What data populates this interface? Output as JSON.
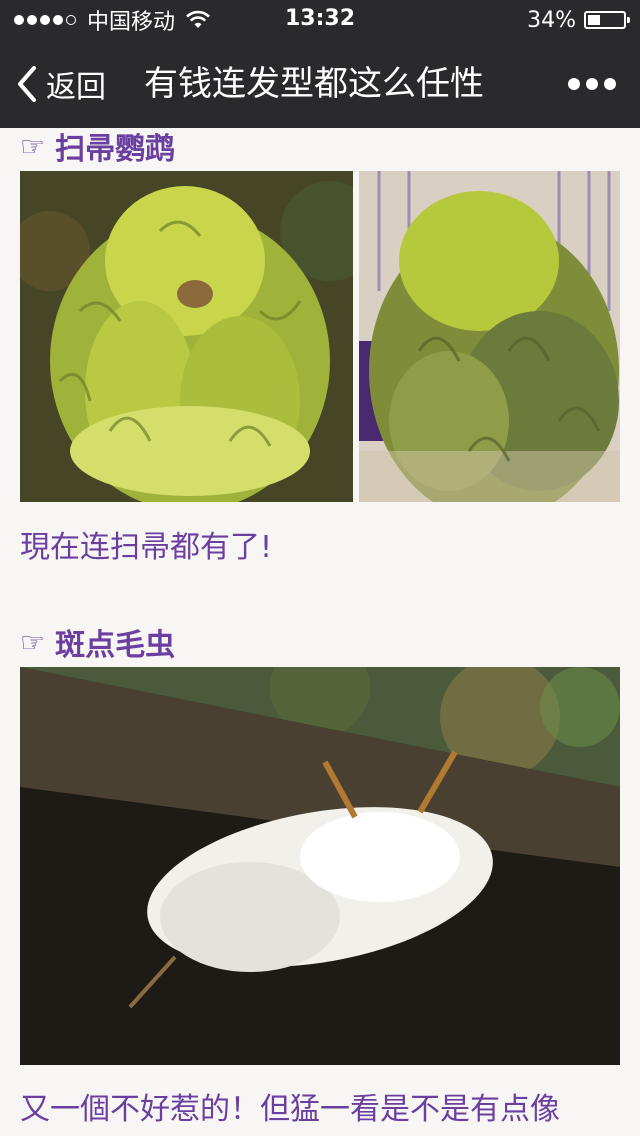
{
  "status_bar": {
    "carrier": "中国移动",
    "time": "13:32",
    "battery_text": "34%",
    "battery_level": 0.34
  },
  "nav": {
    "back_label": "返回",
    "title": "有钱连发型都这么任性"
  },
  "sections": [
    {
      "hand_icon": "☞",
      "heading": "扫帚鹦鹉",
      "caption": "現在连扫帚都有了!"
    },
    {
      "hand_icon": "☞",
      "heading": "斑点毛虫",
      "caption": "又一個不好惹的！但猛一看是不是有点像"
    }
  ],
  "colors": {
    "bar_bg": "#2a2a2c",
    "accent_purple": "#6b3fa0",
    "page_bg": "#f7f6f4"
  },
  "icons": {
    "back": "chevron-left-icon",
    "more": "more-dots-icon",
    "wifi": "wifi-icon",
    "battery": "battery-icon",
    "hand": "pointing-hand-icon"
  }
}
